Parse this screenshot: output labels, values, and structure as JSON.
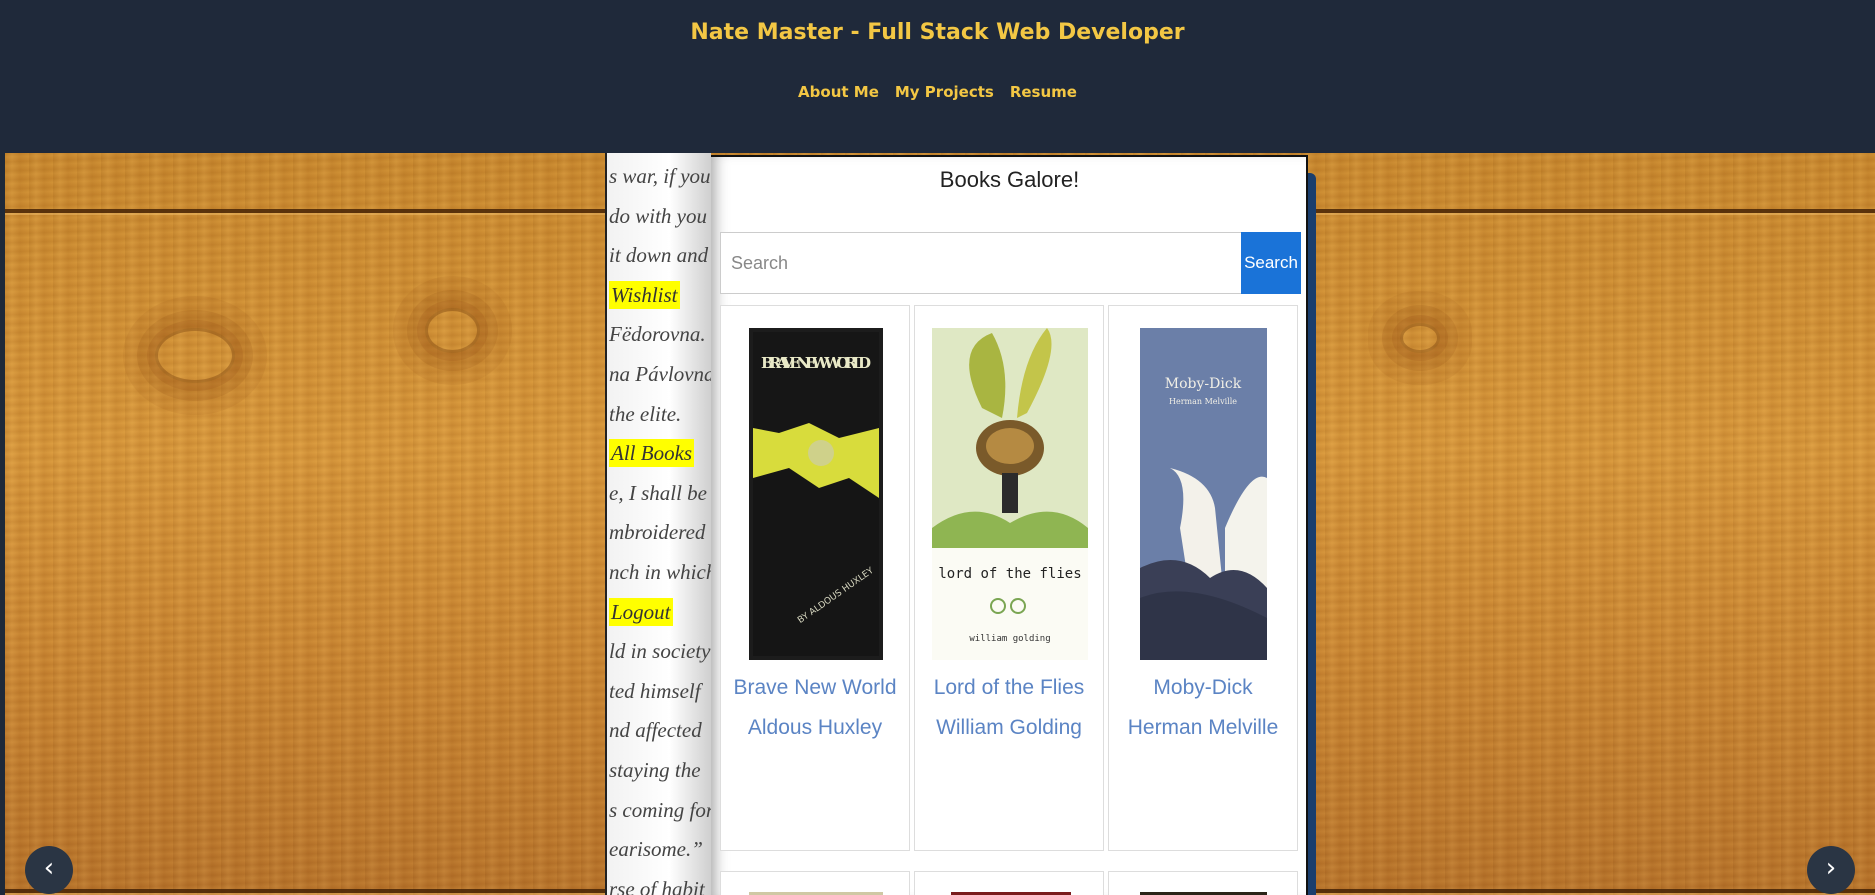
{
  "header": {
    "title": "Nate Master - Full Stack Web Developer",
    "nav": [
      "About Me",
      "My Projects",
      "Resume"
    ]
  },
  "left_page": {
    "lines": [
      "s war, if you",
      "do with you",
      "it down and",
      "Wishlist",
      "Fëdorovna.",
      "na Pávlovna",
      "the elite.",
      "All Books",
      "e, I shall be",
      "mbroidered",
      "nch in which",
      "Logout",
      "ld in society",
      "ted himself",
      "nd affected",
      "staying the",
      "s coming for",
      "earisome.”",
      "rse of habit"
    ],
    "links": {
      "wishlist": "Wishlist",
      "all_books": "All Books",
      "logout": "Logout"
    }
  },
  "right_page": {
    "title": "Books Galore!",
    "search_placeholder": "Search",
    "search_button": "Search",
    "books": [
      {
        "title": "Brave New World",
        "author": "Aldous Huxley",
        "cover_text": "BRAVE NEW WORLD",
        "cover_author": "BY ALDOUS HUXLEY"
      },
      {
        "title": "Lord of the Flies",
        "author": "William Golding",
        "cover_text": "lord of the flies",
        "cover_author": "william golding"
      },
      {
        "title": "Moby-Dick",
        "author": "Herman Melville",
        "cover_text": "Moby-Dick",
        "cover_author": "Herman Melville"
      }
    ]
  },
  "carousel": {
    "prev_icon": "‹",
    "next_icon": "›"
  },
  "colors": {
    "header_bg": "#1f293a",
    "accent": "#f3c744",
    "link_blue": "#5b84c4",
    "button_blue": "#1a73d8",
    "highlight": "#ffff00"
  }
}
